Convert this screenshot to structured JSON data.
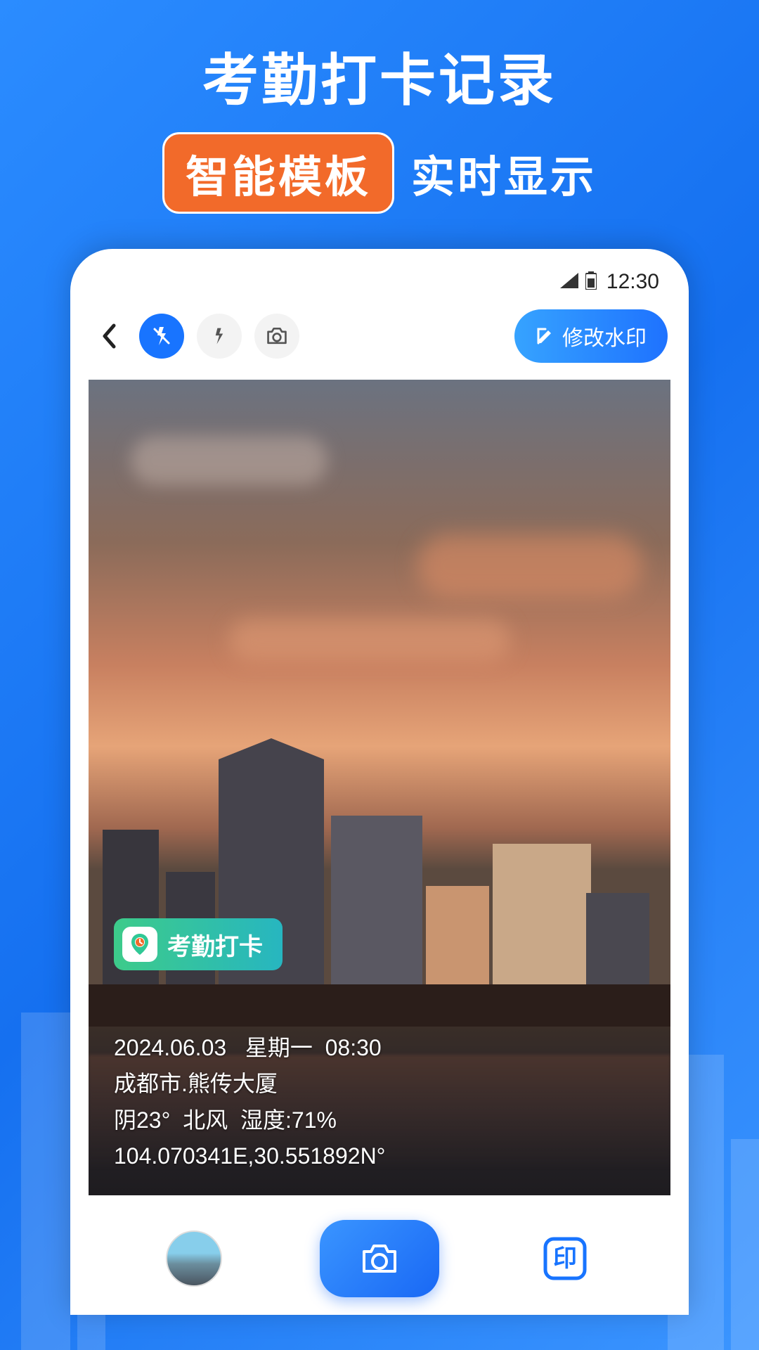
{
  "hero": {
    "title": "考勤打卡记录",
    "badge": "智能模板",
    "subtitle": "实时显示"
  },
  "status_bar": {
    "time": "12:30"
  },
  "toolbar": {
    "edit_watermark": "修改水印"
  },
  "watermark": {
    "badge_label": "考勤打卡",
    "date": "2024.06.03",
    "weekday": "星期一",
    "time": "08:30",
    "location": "成都市.熊传大厦",
    "weather": "阴23°",
    "wind": "北风",
    "humidity_label": "湿度",
    "humidity_value": "71%",
    "coords": "104.070341E,30.551892N°"
  },
  "bottom_nav": {
    "stamp_label": "印"
  }
}
